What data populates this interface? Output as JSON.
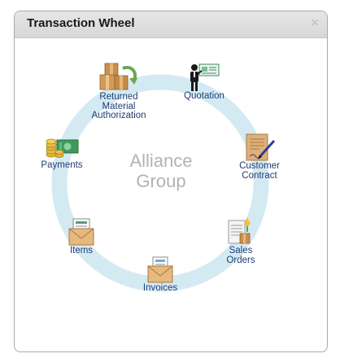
{
  "panel": {
    "title": "Transaction Wheel",
    "close_glyph": "×"
  },
  "center": {
    "line1": "Alliance",
    "line2": "Group"
  },
  "nodes": {
    "rma": {
      "lines": [
        "Returned",
        "Material",
        "Authorization"
      ],
      "icon": "boxes-return-icon"
    },
    "quotation": {
      "label": "Quotation",
      "icon": "person-presenting-icon"
    },
    "customer_contract": {
      "lines": [
        "Customer",
        "Contract"
      ],
      "icon": "contract-pen-icon"
    },
    "sales_orders": {
      "lines": [
        "Sales",
        "Orders"
      ],
      "icon": "sales-order-icon"
    },
    "invoices": {
      "label": "Invoices",
      "icon": "envelope-invoice-icon"
    },
    "items": {
      "label": "Items",
      "icon": "envelope-items-icon"
    },
    "payments": {
      "label": "Payments",
      "icon": "cash-coins-icon"
    }
  },
  "colors": {
    "ring": "#d4eaf3",
    "label": "#1f3c73",
    "center_text": "#b3b3b3"
  }
}
